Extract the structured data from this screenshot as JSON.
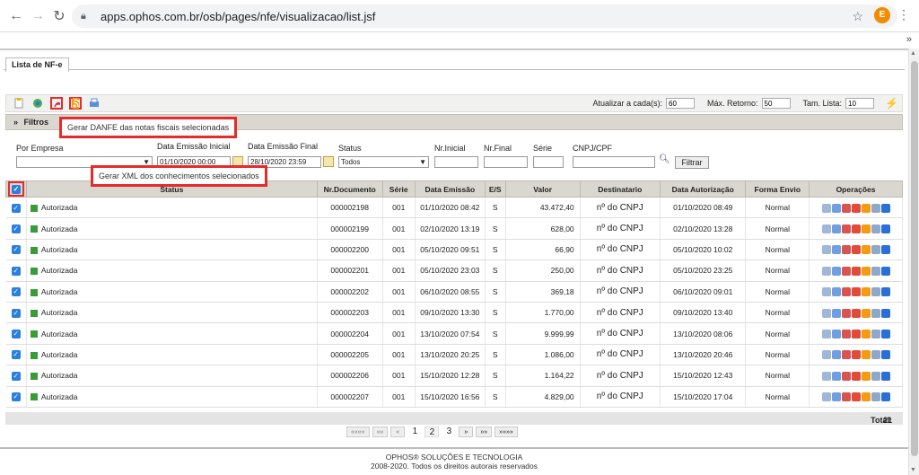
{
  "browser": {
    "url": "apps.ophos.com.br/osb/pages/nfe/visualizacao/list.jsf",
    "profile_initial": "E"
  },
  "tab": {
    "label": "Lista de NF-e"
  },
  "tooltips": {
    "danfe": "Gerar DANFE das notas fiscais selecionadas",
    "xml": "Gerar XML dos conhecimentos selecionados"
  },
  "toolbar": {
    "atualizar_label": "Atualizar a cada(s):",
    "atualizar_value": "60",
    "max_retorno_label": "Máx. Retorno:",
    "max_retorno_value": "50",
    "tam_lista_label": "Tam. Lista:",
    "tam_lista_value": "10"
  },
  "filters": {
    "header": "Filtros",
    "por_empresa_label": "Por Empresa",
    "por_empresa_value": "",
    "data_inicial_label": "Data Emissão Inicial",
    "data_inicial_value": "01/10/2020 00:00",
    "data_final_label": "Data Emissão Final",
    "data_final_value": "28/10/2020 23:59",
    "status_label": "Status",
    "status_value": "Todos",
    "nr_inicial_label": "Nr.Inicial",
    "nr_final_label": "Nr.Final",
    "serie_label": "Série",
    "cnpj_label": "CNPJ/CPF",
    "filtrar_label": "Filtrar"
  },
  "table": {
    "headers": [
      "Status",
      "Nr.Documento",
      "Série",
      "Data Emissão",
      "E/S",
      "Valor",
      "Destinatario",
      "Data Autorização",
      "Forma Envio",
      "Operações"
    ],
    "rows": [
      {
        "status": "Autorizada",
        "nr": "000002198",
        "serie": "001",
        "emissao": "01/10/2020 08:42",
        "es": "S",
        "valor": "43.472,40",
        "dest": "nº do CNPJ",
        "autorizacao": "01/10/2020 08:49",
        "envio": "Normal"
      },
      {
        "status": "Autorizada",
        "nr": "000002199",
        "serie": "001",
        "emissao": "02/10/2020 13:19",
        "es": "S",
        "valor": "628,00",
        "dest": "nº do CNPJ",
        "autorizacao": "02/10/2020 13:28",
        "envio": "Normal"
      },
      {
        "status": "Autorizada",
        "nr": "000002200",
        "serie": "001",
        "emissao": "05/10/2020 09:51",
        "es": "S",
        "valor": "66,90",
        "dest": "nº do CNPJ",
        "autorizacao": "05/10/2020 10:02",
        "envio": "Normal"
      },
      {
        "status": "Autorizada",
        "nr": "000002201",
        "serie": "001",
        "emissao": "05/10/2020 23:03",
        "es": "S",
        "valor": "250,00",
        "dest": "nº do CNPJ",
        "autorizacao": "05/10/2020 23:25",
        "envio": "Normal"
      },
      {
        "status": "Autorizada",
        "nr": "000002202",
        "serie": "001",
        "emissao": "06/10/2020 08:55",
        "es": "S",
        "valor": "369,18",
        "dest": "nº do CNPJ",
        "autorizacao": "06/10/2020 09:01",
        "envio": "Normal"
      },
      {
        "status": "Autorizada",
        "nr": "000002203",
        "serie": "001",
        "emissao": "09/10/2020 13:30",
        "es": "S",
        "valor": "1.770,00",
        "dest": "nº do CNPJ",
        "autorizacao": "09/10/2020 13:40",
        "envio": "Normal"
      },
      {
        "status": "Autorizada",
        "nr": "000002204",
        "serie": "001",
        "emissao": "13/10/2020 07:54",
        "es": "S",
        "valor": "9.999,99",
        "dest": "nº do CNPJ",
        "autorizacao": "13/10/2020 08:06",
        "envio": "Normal"
      },
      {
        "status": "Autorizada",
        "nr": "000002205",
        "serie": "001",
        "emissao": "13/10/2020 20:25",
        "es": "S",
        "valor": "1.086,00",
        "dest": "nº do CNPJ",
        "autorizacao": "13/10/2020 20:46",
        "envio": "Normal"
      },
      {
        "status": "Autorizada",
        "nr": "000002206",
        "serie": "001",
        "emissao": "15/10/2020 12:28",
        "es": "S",
        "valor": "1.164,22",
        "dest": "nº do CNPJ",
        "autorizacao": "15/10/2020 12:43",
        "envio": "Normal"
      },
      {
        "status": "Autorizada",
        "nr": "000002207",
        "serie": "001",
        "emissao": "15/10/2020 16:56",
        "es": "S",
        "valor": "4.829,00",
        "dest": "nº do CNPJ",
        "autorizacao": "15/10/2020 17:04",
        "envio": "Normal"
      }
    ],
    "total_label": "Total:",
    "total_value": "21"
  },
  "pager": {
    "first": "««««",
    "prev_fast": "««",
    "prev": "«",
    "pages": [
      "1",
      "2",
      "3"
    ],
    "next": "»",
    "next_fast": "»»",
    "last": "»»»»"
  },
  "footer": {
    "line1": "OPHOS® SOLUÇÕES E TECNOLOGIA",
    "line2": "2008-2020. Todos os direitos autorais reservados"
  },
  "colors": {
    "highlight": "#e52b2b",
    "header_bg": "#d9d7cf",
    "checkbox": "#2b7fde"
  }
}
